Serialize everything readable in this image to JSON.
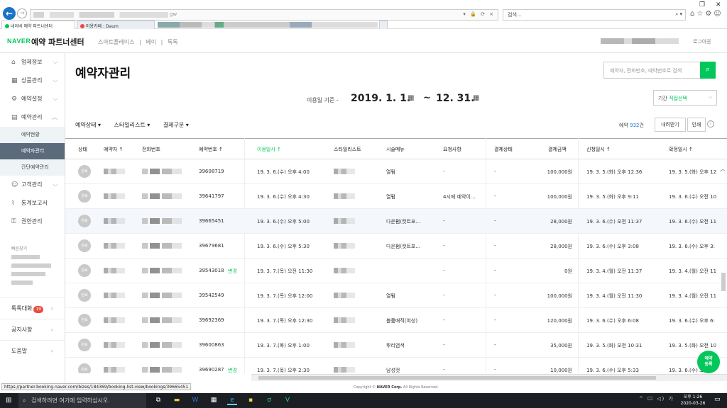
{
  "browser": {
    "address_tail": "gw",
    "search_placeholder": "검색...",
    "tabs": [
      {
        "label": "네이버 예약 파트너센터"
      },
      {
        "label": "미용카페 : Daum"
      }
    ],
    "status_url": "https://partner.booking.naver.com/bizes/184369/booking-list-view/bookings/39665451"
  },
  "header": {
    "logo": "NAVER",
    "title": "예약 파트너센터",
    "links": [
      "스마트플레이스",
      "|",
      "페이",
      "|",
      "톡톡"
    ],
    "logout": "로그아웃"
  },
  "sidebar": {
    "items": [
      {
        "label": "업체정보",
        "icon": "home-icon"
      },
      {
        "label": "상품관리",
        "icon": "grid-icon"
      },
      {
        "label": "예약설정",
        "icon": "gear-icon"
      },
      {
        "label": "예약관리",
        "icon": "calendar-icon"
      }
    ],
    "sub_items": [
      {
        "label": "예약현황"
      },
      {
        "label": "예약자관리"
      },
      {
        "label": "간단예약관리"
      }
    ],
    "items2": [
      {
        "label": "고객관리",
        "icon": "user-icon"
      },
      {
        "label": "통계보고서",
        "icon": "chart-icon"
      },
      {
        "label": "권한관리",
        "icon": "key-icon"
      }
    ],
    "shortcut_label": "빠른찾기",
    "footer": [
      {
        "label": "톡톡대화",
        "badge": "19"
      },
      {
        "label": "공지사항"
      },
      {
        "label": "도움말"
      }
    ]
  },
  "main": {
    "title": "예약자관리",
    "search_placeholder": "예약자, 전화번호, 예약번호로 검색",
    "date_label": "이용일 기준 -",
    "date_start": "2019. 1. 1.",
    "date_sep": "~",
    "date_end": "12. 31.",
    "period_label": "기간",
    "period_value": "직접선택",
    "filters": [
      "예약상태 ▾",
      "스타일리스트 ▾",
      "결제구분 ▾"
    ],
    "count_prefix": "예약",
    "count_value": "932",
    "count_suffix": "건",
    "download_label": "내려받기",
    "print_label": "인쇄"
  },
  "table": {
    "headers": [
      "상태",
      "예약자 ↑",
      "전화번호",
      "예약번호 ↑",
      "이용일시 ↑",
      "스타일리스트",
      "시술메뉴",
      "요청사항",
      "결제상태",
      "결제금액",
      "신청일시 ↑",
      "확정일시 ↑"
    ],
    "rows": [
      {
        "status": "완료",
        "booking_no": "39608719",
        "tag": "",
        "use_date": "19. 3. 6.(수) 오후 4:00",
        "menu": "열펌",
        "request": "-",
        "pay_status": "-",
        "amount": "100,000원",
        "applied": "19. 3. 5.(화) 오후 12:36",
        "confirmed": "19. 3. 5.(화) 오후 12"
      },
      {
        "status": "완료",
        "booking_no": "39641797",
        "tag": "",
        "use_date": "19. 3. 6.(수) 오후 4:30",
        "menu": "열펌",
        "request": "4시에 예약이...",
        "pay_status": "-",
        "amount": "100,000원",
        "applied": "19. 3. 5.(화) 오후 9:11",
        "confirmed": "19. 3. 6.(수) 오전 10"
      },
      {
        "status": "완료",
        "booking_no": "39665451",
        "tag": "",
        "use_date": "19. 3. 6.(수) 오후 5:00",
        "menu": "다운펌(컷트포...",
        "request": "-",
        "pay_status": "-",
        "amount": "28,000원",
        "applied": "19. 3. 6.(수) 오전 11:37",
        "confirmed": "19. 3. 6.(수) 오전 11"
      },
      {
        "status": "완료",
        "booking_no": "39679681",
        "tag": "",
        "use_date": "19. 3. 6.(수) 오후 5:30",
        "menu": "다운펌(컷트포...",
        "request": "-",
        "pay_status": "-",
        "amount": "28,000원",
        "applied": "19. 3. 6.(수) 오후 3:08",
        "confirmed": "19. 3. 6.(수) 오후 3:"
      },
      {
        "status": "완료",
        "booking_no": "39543018",
        "tag": "변경",
        "use_date": "19. 3. 7.(목) 오전 11:30",
        "menu": "",
        "request": "-",
        "pay_status": "-",
        "amount": "0원",
        "applied": "19. 3. 4.(월) 오전 11:37",
        "confirmed": "19. 3. 4.(월) 오전 11"
      },
      {
        "status": "완료",
        "booking_no": "39542549",
        "tag": "",
        "use_date": "19. 3. 7.(목) 오후 12:00",
        "menu": "열펌",
        "request": "-",
        "pay_status": "-",
        "amount": "100,000원",
        "applied": "19. 3. 4.(월) 오전 11:30",
        "confirmed": "19. 3. 4.(월) 오전 11"
      },
      {
        "status": "완료",
        "booking_no": "39692369",
        "tag": "",
        "use_date": "19. 3. 7.(목) 오후 12:30",
        "menu": "볼륨매직(여성)",
        "request": "-",
        "pay_status": "-",
        "amount": "120,000원",
        "applied": "19. 3. 6.(수) 오후 6:08",
        "confirmed": "19. 3. 6.(수) 오후 6:"
      },
      {
        "status": "완료",
        "booking_no": "39600863",
        "tag": "",
        "use_date": "19. 3. 7.(목) 오후 1:00",
        "menu": "뿌리염색",
        "request": "-",
        "pay_status": "-",
        "amount": "35,000원",
        "applied": "19. 3. 5.(화) 오전 10:31",
        "confirmed": "19. 3. 5.(화) 오전 10"
      },
      {
        "status": "완료",
        "booking_no": "39690287",
        "tag": "변경",
        "use_date": "19. 3. 7.(목) 오후 2:30",
        "menu": "남성컷",
        "request": "-",
        "pay_status": "-",
        "amount": "10,000원",
        "applied": "19. 3. 6.(수) 오후 5:33",
        "confirmed": "19. 3. 6.(수) 오후 5"
      }
    ]
  },
  "fab": {
    "line1": "예약",
    "line2": "등록"
  },
  "footer": {
    "copyright": "Copyright ©",
    "brand": "NAVER Corp.",
    "rights": "All Rights Reserved."
  },
  "taskbar": {
    "search_placeholder": "검색하려면 여기에 입력하십시오.",
    "clock_time": "오후 1:26",
    "clock_date": "2020-03-26",
    "tray": "^ 🖵 ◁) 가"
  }
}
